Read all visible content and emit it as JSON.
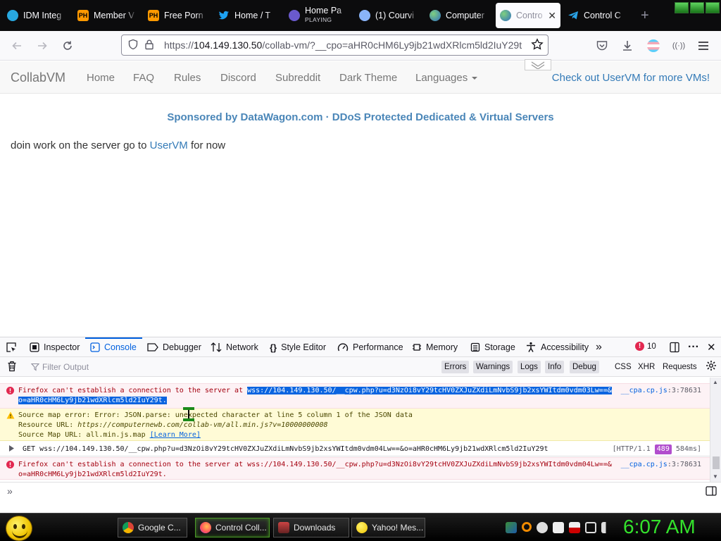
{
  "browser": {
    "tabs": [
      {
        "title": "IDM Integ",
        "icon_color": "#28a8e0",
        "icon": "idm-icon"
      },
      {
        "title": "Member V",
        "icon_color": "#f90",
        "icon": "ph-icon",
        "icon_text": "PH"
      },
      {
        "title": "Free Porn",
        "icon_color": "#f90",
        "icon": "ph-icon",
        "icon_text": "PH"
      },
      {
        "title": "Home / T",
        "icon_color": "#1da1f2",
        "icon": "twitter-icon"
      },
      {
        "title": "Home Pa",
        "subtitle": "PLAYING",
        "icon_color": "#6a5acd",
        "icon": "site-icon"
      },
      {
        "title": "(1) Courvi",
        "icon_color": "#8ab4f8",
        "icon": "site-icon"
      },
      {
        "title": "Computer",
        "icon_color": "#4a8fd8",
        "icon": "globe-icon"
      },
      {
        "title": "Contro",
        "icon_color": "#4a8fd8",
        "icon": "globe-icon",
        "active": true
      },
      {
        "title": "Control C",
        "icon_color": "#2aa4e8",
        "icon": "telegram-icon"
      }
    ],
    "new_tab_label": "+",
    "url_prefix": "https://",
    "url_host": "104.149.130.50",
    "url_rest": "/collab-vm/?__cpo=aHR0cHM6Ly9jb21wdXRlcm5ld2IuY29t"
  },
  "site": {
    "brand": "CollabVM",
    "nav": [
      "Home",
      "FAQ",
      "Rules",
      "Discord",
      "Subreddit",
      "Dark Theme",
      "Languages"
    ],
    "promo": "Check out UserVM for more VMs!",
    "sponsor": "Sponsored by DataWagon.com · DDoS Protected Dedicated & Virtual Servers",
    "notice_before": "doin work on the server go to ",
    "notice_link": "UserVM",
    "notice_after": " for now"
  },
  "devtools": {
    "tabs": [
      "Inspector",
      "Console",
      "Debugger",
      "Network",
      "Style Editor",
      "Performance",
      "Memory",
      "Storage",
      "Accessibility"
    ],
    "selected_tab": "Console",
    "error_count": "10",
    "filter_placeholder": "Filter Output",
    "levels": [
      "Errors",
      "Warnings",
      "Logs",
      "Info",
      "Debug"
    ],
    "types": [
      "CSS",
      "XHR",
      "Requests"
    ],
    "messages": [
      {
        "level": "error",
        "prefix": "Firefox can't establish a connection to the server at ",
        "selected": "wss://104.149.130.50/__cpw.php?u=d3NzOi8vY29tcHV0ZXJuZXdiLmNvbS9jb2xsYWItdm0vdm03Lw==&",
        "line2": "o=aHR0cHM6Ly9jb21wdXRlcm5ld2IuY29t.",
        "source": "__cpa.cp.js",
        "position": ":3:78631"
      },
      {
        "level": "warning",
        "line1": "Source map error: Error: JSON.parse: unexpected character at line 5 column 1 of the JSON data",
        "line2_label": "Resource URL: ",
        "line2_value": "https://computernewb.com/collab-vm/all.min.js?v=10000000008",
        "line3_label": "Source Map URL: all.min.js.map ",
        "line3_link": "[Learn More]"
      },
      {
        "level": "network",
        "text": "GET wss://104.149.130.50/__cpw.php?u=d3NzOi8vY29tcHV0ZXJuZXdiLmNvbS9jb2xsYWItdm0vdm04Lw==&o=aHR0cHM6Ly9jb21wdXRlcm5ld2IuY29t",
        "protocol": "[HTTP/1.1",
        "status": "489",
        "time": "584ms]"
      },
      {
        "level": "error",
        "line1": "Firefox can't establish a connection to the server at wss://104.149.130.50/__cpw.php?u=d3NzOi8vY29tcHV0ZXJuZXdiLmNvbS9jb2xsYWItdm0vdm04Lw==&",
        "line2": "o=aHR0cHM6Ly9jb21wdXRlcm5ld2IuY29t.",
        "source": "__cpa.cp.js",
        "position": ":3:78631"
      }
    ]
  },
  "taskbar": {
    "items": [
      "Google C...",
      "Control Coll...",
      "Downloads",
      "Yahoo! Mes..."
    ],
    "active_item": "Control Coll...",
    "clock": "6:07 AM"
  },
  "colors": {
    "accent": "#0060df",
    "error": "#a4000f",
    "link": "#337ab7",
    "clock": "#34e22c"
  }
}
